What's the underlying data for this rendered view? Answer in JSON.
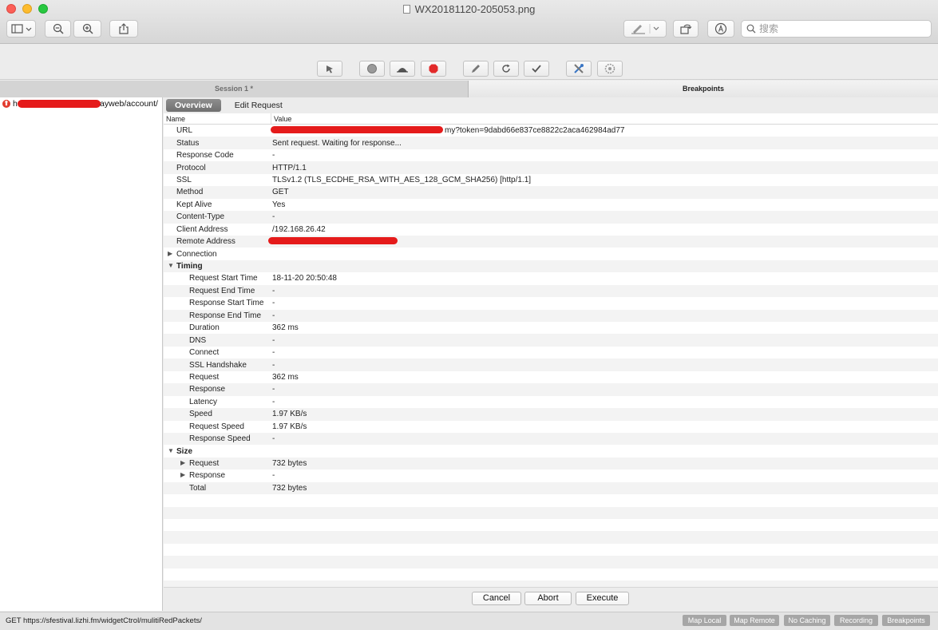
{
  "window": {
    "title": "WX20181120-205053.png",
    "search_placeholder": "搜索"
  },
  "icons": {
    "sidebar": "sidebar-icon",
    "zoom_out": "zoom-out-icon",
    "zoom_in": "zoom-in-icon",
    "share": "share-icon",
    "markup": "pen-icon",
    "rotate": "rotate-icon",
    "annotate": "annotate-icon",
    "search": "search-icon"
  },
  "charles_toolbar": [
    {
      "name": "clear-session-icon"
    },
    {
      "name": "record-icon"
    },
    {
      "name": "throttle-icon"
    },
    {
      "name": "breakpoints-icon"
    },
    {
      "name": "compose-icon"
    },
    {
      "name": "repeat-icon"
    },
    {
      "name": "validate-icon"
    },
    {
      "name": "tools-icon"
    },
    {
      "name": "settings-icon"
    }
  ],
  "tabs": {
    "session": "Session 1 *",
    "breakpoints": "Breakpoints"
  },
  "tree": {
    "item_prefix": "h",
    "item_suffix": "ayweb/account/"
  },
  "subtabs": {
    "overview": "Overview",
    "edit_request": "Edit Request"
  },
  "table": {
    "col_name": "Name",
    "col_value": "Value",
    "rows": [
      {
        "name": "URL",
        "value": "my?token=9dabd66e837ce8822c2aca462984ad77",
        "indent": 1,
        "tri": ""
      },
      {
        "name": "Status",
        "value": "Sent request. Waiting for response...",
        "indent": 1,
        "tri": ""
      },
      {
        "name": "Response Code",
        "value": "-",
        "indent": 1,
        "tri": ""
      },
      {
        "name": "Protocol",
        "value": "HTTP/1.1",
        "indent": 1,
        "tri": ""
      },
      {
        "name": "SSL",
        "value": "TLSv1.2 (TLS_ECDHE_RSA_WITH_AES_128_GCM_SHA256) [http/1.1]",
        "indent": 1,
        "tri": ""
      },
      {
        "name": "Method",
        "value": "GET",
        "indent": 1,
        "tri": ""
      },
      {
        "name": "Kept Alive",
        "value": "Yes",
        "indent": 1,
        "tri": ""
      },
      {
        "name": "Content-Type",
        "value": "-",
        "indent": 1,
        "tri": ""
      },
      {
        "name": "Client Address",
        "value": "/192.168.26.42",
        "indent": 1,
        "tri": ""
      },
      {
        "name": "Remote Address",
        "value": "",
        "indent": 1,
        "tri": ""
      },
      {
        "name": "Connection",
        "value": "",
        "indent": 1,
        "tri": "▶"
      },
      {
        "name": "Timing",
        "value": "",
        "indent": 1,
        "tri": "▼",
        "section": true
      },
      {
        "name": "Request Start Time",
        "value": "18-11-20 20:50:48",
        "indent": 2,
        "tri": ""
      },
      {
        "name": "Request End Time",
        "value": "-",
        "indent": 2,
        "tri": ""
      },
      {
        "name": "Response Start Time",
        "value": "-",
        "indent": 2,
        "tri": ""
      },
      {
        "name": "Response End Time",
        "value": "-",
        "indent": 2,
        "tri": ""
      },
      {
        "name": "Duration",
        "value": "362 ms",
        "indent": 2,
        "tri": ""
      },
      {
        "name": "DNS",
        "value": "-",
        "indent": 2,
        "tri": ""
      },
      {
        "name": "Connect",
        "value": "-",
        "indent": 2,
        "tri": ""
      },
      {
        "name": "SSL Handshake",
        "value": "-",
        "indent": 2,
        "tri": ""
      },
      {
        "name": "Request",
        "value": "362 ms",
        "indent": 2,
        "tri": ""
      },
      {
        "name": "Response",
        "value": "-",
        "indent": 2,
        "tri": ""
      },
      {
        "name": "Latency",
        "value": "-",
        "indent": 2,
        "tri": ""
      },
      {
        "name": "Speed",
        "value": "1.97 KB/s",
        "indent": 2,
        "tri": ""
      },
      {
        "name": "Request Speed",
        "value": "1.97 KB/s",
        "indent": 2,
        "tri": ""
      },
      {
        "name": "Response Speed",
        "value": "-",
        "indent": 2,
        "tri": ""
      },
      {
        "name": "Size",
        "value": "",
        "indent": 1,
        "tri": "▼",
        "section": true
      },
      {
        "name": "Request",
        "value": "732 bytes",
        "indent": 2,
        "tri": "▶"
      },
      {
        "name": "Response",
        "value": "-",
        "indent": 2,
        "tri": "▶"
      },
      {
        "name": "Total",
        "value": "732 bytes",
        "indent": 2,
        "tri": ""
      }
    ]
  },
  "actions": {
    "cancel": "Cancel",
    "abort": "Abort",
    "execute": "Execute"
  },
  "status": {
    "text": "GET https://sfestival.lizhi.fm/widgetCtrol/mulitiRedPackets/",
    "map_local": "Map Local",
    "map_remote": "Map Remote",
    "no_caching": "No Caching",
    "recording": "Recording",
    "breakpoints": "Breakpoints"
  }
}
